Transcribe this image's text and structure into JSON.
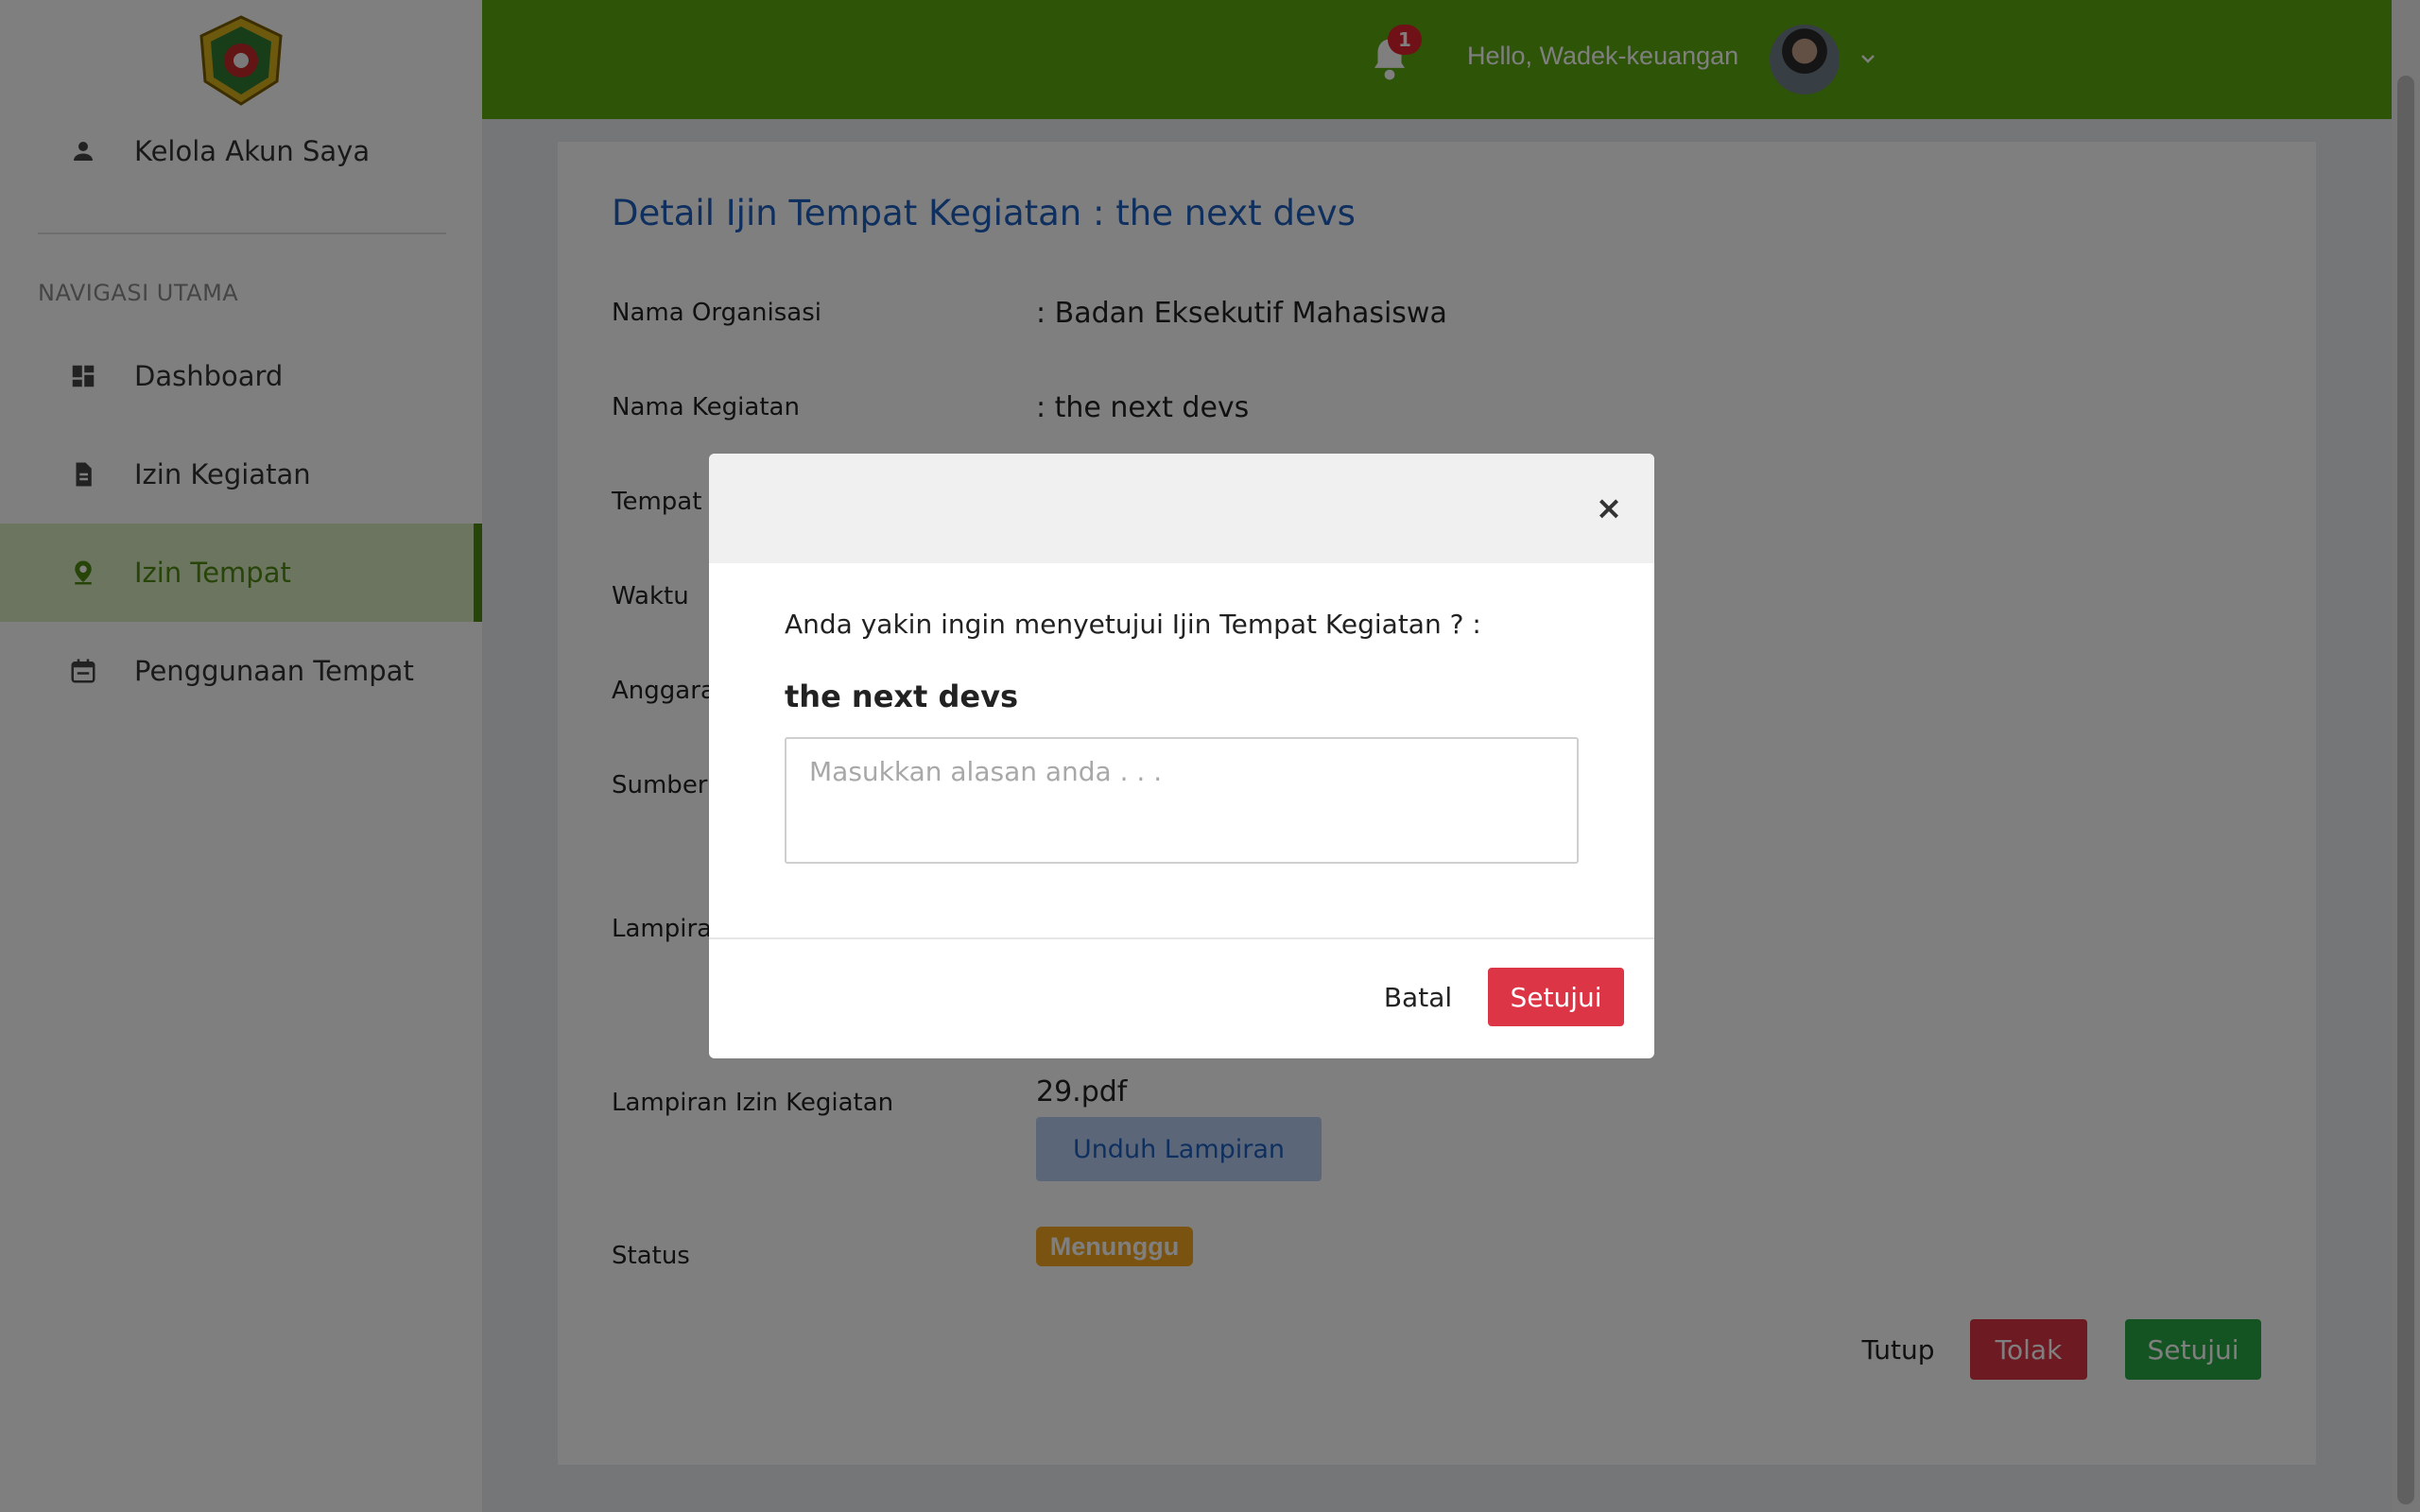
{
  "sidebar": {
    "account_label": "Kelola Akun Saya",
    "section_title": "NAVIGASI UTAMA",
    "items": [
      {
        "label": "Dashboard",
        "icon": "dashboard-icon"
      },
      {
        "label": "Izin Kegiatan",
        "icon": "document-icon"
      },
      {
        "label": "Izin Tempat",
        "icon": "location-pin-icon",
        "active": true
      },
      {
        "label": "Penggunaan Tempat",
        "icon": "calendar-icon"
      }
    ]
  },
  "topbar": {
    "notification_count": "1",
    "greeting": "Hello, Wadek-keuangan"
  },
  "detail": {
    "title": "Detail Ijin Tempat Kegiatan : the next devs",
    "rows": [
      {
        "label": "Nama Organisasi",
        "value": ": Badan Eksekutif Mahasiswa"
      },
      {
        "label": "Nama Kegiatan",
        "value": ": the next devs"
      },
      {
        "label": "Tempat",
        "value": ""
      },
      {
        "label": "Waktu",
        "value": ""
      },
      {
        "label": "Anggaran",
        "value": ""
      },
      {
        "label": "Sumber A",
        "value": ""
      },
      {
        "label": "Lampiran",
        "value": ""
      },
      {
        "label": "Lampiran Izin Kegiatan",
        "value": "29.pdf"
      },
      {
        "label": "Status",
        "value": ""
      }
    ],
    "download_label": "Unduh Lampiran",
    "status_badge": "Menunggu",
    "buttons": {
      "close": "Tutup",
      "reject": "Tolak",
      "approve": "Setujui"
    }
  },
  "modal": {
    "close_symbol": "×",
    "question": "Anda yakin ingin menyetujui Ijin Tempat Kegiatan ? :",
    "subject": "the next devs",
    "reason_placeholder": "Masukkan alasan anda . . .",
    "reason_value": "",
    "cancel_label": "Batal",
    "confirm_label": "Setujui"
  },
  "colors": {
    "topbar": "#5aa80e",
    "active_nav": "#4f8a10",
    "title_blue": "#1f5fbf",
    "danger": "#dc3545",
    "success": "#28a745",
    "warning": "#f5a623"
  }
}
